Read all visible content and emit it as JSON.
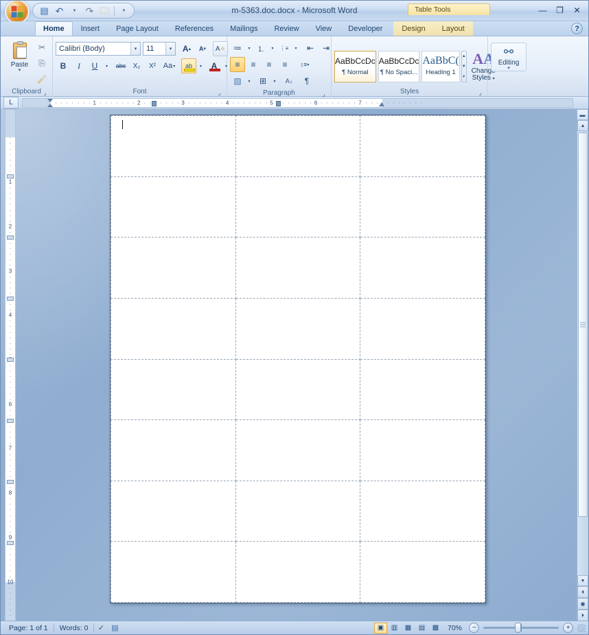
{
  "window": {
    "title": "m-5363.doc.docx - Microsoft Word",
    "contextual_tab_group": "Table Tools",
    "minimize": "—",
    "maximize": "❐",
    "close": "✕",
    "help": "?"
  },
  "office_button": {
    "label": "Office Button"
  },
  "quick_access": [
    {
      "name": "save",
      "glyph": "💾",
      "label": "Save"
    },
    {
      "name": "undo",
      "glyph": "↶",
      "label": "Undo"
    },
    {
      "name": "undo-dropdown",
      "glyph": "▾",
      "label": "Undo options"
    },
    {
      "name": "redo",
      "glyph": "↷",
      "label": "Redo"
    },
    {
      "name": "open",
      "glyph": "📂",
      "label": "Open"
    },
    {
      "name": "customize",
      "glyph": "▾",
      "label": "Customize Quick Access Toolbar"
    }
  ],
  "tabs": [
    {
      "label": "Home",
      "active": true
    },
    {
      "label": "Insert",
      "active": false
    },
    {
      "label": "Page Layout",
      "active": false
    },
    {
      "label": "References",
      "active": false
    },
    {
      "label": "Mailings",
      "active": false
    },
    {
      "label": "Review",
      "active": false
    },
    {
      "label": "View",
      "active": false
    },
    {
      "label": "Developer",
      "active": false
    }
  ],
  "contextual_tabs": [
    {
      "label": "Design",
      "active": false
    },
    {
      "label": "Layout",
      "active": false
    }
  ],
  "ribbon": {
    "clipboard": {
      "group_label": "Clipboard",
      "paste_label": "Paste",
      "paste_caret": "▾",
      "cut_label": "Cut",
      "cut_glyph": "✂",
      "copy_label": "Copy",
      "copy_glyph": "⎘",
      "format_painter_label": "Format Painter",
      "format_painter_glyph": "🖌",
      "dialog_launcher": "⌟"
    },
    "font": {
      "group_label": "Font",
      "font_name": "Calibri (Body)",
      "font_size": "11",
      "dropdown_arrow": "▾",
      "grow_font": "A",
      "shrink_font": "A",
      "clear_formatting_label": "Clear Formatting",
      "clear_formatting_glyph": "A",
      "bold": "B",
      "italic": "I",
      "underline": "U",
      "underline_caret": "▾",
      "strikethrough": "abc",
      "subscript": "X₂",
      "superscript": "X²",
      "change_case": "Aa",
      "change_case_caret": "▾",
      "highlight_label": "Text Highlight Color",
      "highlight_glyph": "ab",
      "highlight_caret": "▾",
      "highlight_color": "#ffe600",
      "font_color_label": "Font Color",
      "font_color_glyph": "A",
      "font_color_caret": "▾",
      "font_color": "#c0211c",
      "dialog_launcher": "⌟"
    },
    "paragraph": {
      "group_label": "Paragraph",
      "bullets": "≔",
      "bullets_caret": "▾",
      "numbering": "⒈",
      "numbering_caret": "▾",
      "multilevel": "⋮≡",
      "multilevel_caret": "▾",
      "decrease_indent": "⇤",
      "increase_indent": "⇥",
      "align_left": "≡",
      "align_center": "≡",
      "align_right": "≡",
      "justify": "≡",
      "line_spacing": "↕≡",
      "line_spacing_caret": "▾",
      "shading": "▨",
      "shading_caret": "▾",
      "borders": "⊞",
      "borders_caret": "▾",
      "sort": "A↓",
      "show_marks": "¶",
      "dialog_launcher": "⌟"
    },
    "styles": {
      "group_label": "Styles",
      "items": [
        {
          "preview": "AaBbCcDc",
          "name": "¶ Normal",
          "active": true,
          "kind": "body"
        },
        {
          "preview": "AaBbCcDc",
          "name": "¶ No Spaci...",
          "active": false,
          "kind": "body"
        },
        {
          "preview": "AaBbC(",
          "name": "Heading 1",
          "active": false,
          "kind": "heading"
        }
      ],
      "scroll_up": "▲",
      "scroll_down": "▼",
      "more": "▾",
      "change_styles_label_line1": "Change",
      "change_styles_label_line2": "Styles",
      "change_styles_caret": "▾",
      "change_styles_glyph": "AA",
      "dialog_launcher": "⌟"
    },
    "editing": {
      "group_label": "",
      "label": "Editing",
      "glyph": "🔍",
      "caret": "▾"
    }
  },
  "ruler": {
    "tab_selector_glyph": "L",
    "horizontal_numbers": [
      "1",
      "2",
      "3",
      "4",
      "5",
      "6",
      "7"
    ],
    "horizontal_unit": "inches",
    "vertical_numbers": [
      "1",
      "2",
      "3",
      "4",
      "5",
      "6",
      "7",
      "8",
      "9",
      "10"
    ],
    "vertical_unit": "inches"
  },
  "document": {
    "page_count": 1,
    "table": {
      "columns": 3,
      "rows": 8,
      "cells_text": [
        [
          "",
          "",
          ""
        ],
        [
          "",
          "",
          ""
        ],
        [
          "",
          "",
          ""
        ],
        [
          "",
          "",
          ""
        ],
        [
          "",
          "",
          ""
        ],
        [
          "",
          "",
          ""
        ],
        [
          "",
          "",
          ""
        ],
        [
          "",
          "",
          ""
        ]
      ]
    },
    "cursor_cell": {
      "row": 0,
      "col": 0
    }
  },
  "scrollbar": {
    "up_arrow": "▲",
    "down_arrow": "▼",
    "previous_page": "⏴",
    "select_browse_object": "◉",
    "next_page": "⏵",
    "split_glyph": "▬"
  },
  "statusbar": {
    "page_info": "Page: 1 of 1",
    "word_count": "Words: 0",
    "proofing_label": "Proofing Errors",
    "proofing_glyph": "✓",
    "macro_label": "Record Macro",
    "macro_glyph": "▤",
    "views": [
      {
        "name": "print-layout",
        "glyph": "▣",
        "active": true
      },
      {
        "name": "full-screen-reading",
        "glyph": "▥",
        "active": false
      },
      {
        "name": "web-layout",
        "glyph": "▦",
        "active": false
      },
      {
        "name": "outline",
        "glyph": "▤",
        "active": false
      },
      {
        "name": "draft",
        "glyph": "▩",
        "active": false
      }
    ],
    "zoom_level": "70%",
    "zoom_out": "−",
    "zoom_in": "+"
  },
  "colors": {
    "accent": "#2a5b8a",
    "ribbon_bg": "#e3ecf8",
    "workspace_bg": "#9fb9d8",
    "highlight_yellow": "#ffe600",
    "font_red": "#c0211c"
  }
}
